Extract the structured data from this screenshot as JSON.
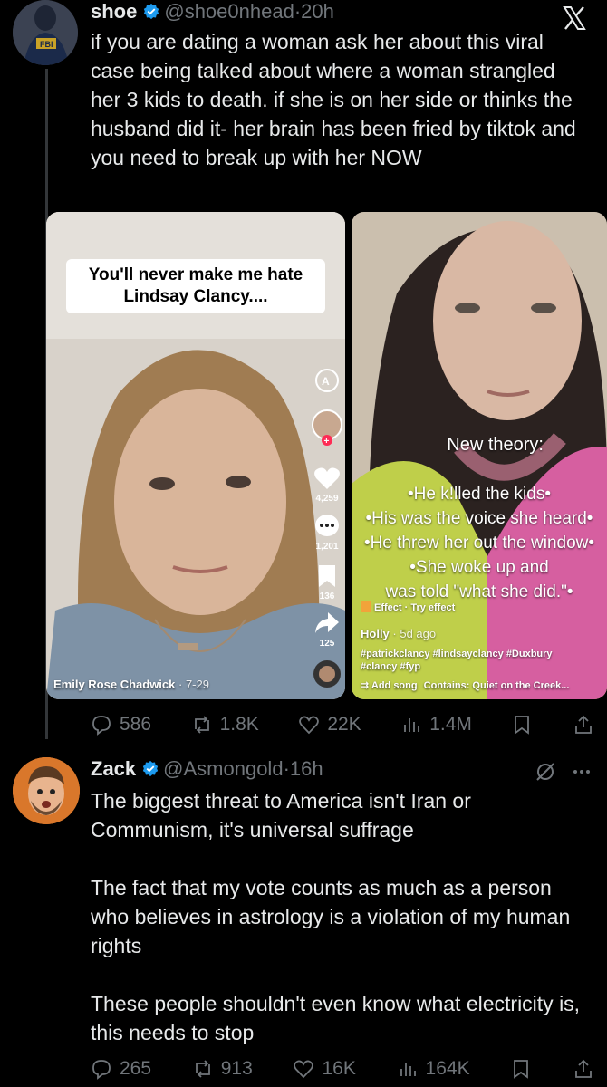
{
  "tweet1": {
    "name": "shoe",
    "handle": "@shoe0nhead",
    "sep": "·",
    "time": "20h",
    "text": "if you are dating a woman ask her about this viral case being talked about where a woman strangled her 3 kids to death. if she is on her side or thinks the husband did it- her brain has been fried by tiktok and you need to break up with her NOW",
    "media_left": {
      "caption_line1": "You'll never make me hate",
      "caption_line2": "Lindsay Clancy....",
      "likes": "4,259",
      "comments": "1,201",
      "bookmarks": "136",
      "shares": "125",
      "author": "Emily Rose Chadwick",
      "date": "· 7-29"
    },
    "media_right": {
      "title": "New theory:",
      "lines": [
        "•He k!lled the kids•",
        "•His was the voice she heard•",
        "•He threw her out the window•",
        "•She woke up and",
        "was told \"what she did.\"•"
      ],
      "effect": "Effect · Try effect",
      "author": "Holly",
      "ago": "· 5d ago",
      "tags1": "#patrickclancy #lindsayclancy #Duxbury",
      "tags2": "#clancy #fyp",
      "add_song": "Add song",
      "contains": "Contains: Quiet on the Creek..."
    },
    "stats": {
      "replies": "586",
      "reposts": "1.8K",
      "likes": "22K",
      "views": "1.4M"
    }
  },
  "tweet2": {
    "name": "Zack",
    "handle": "@Asmongold",
    "sep": "·",
    "time": "16h",
    "para1": "The biggest threat to America isn't Iran or Communism, it's universal suffrage",
    "para2": "The fact that my vote counts as much as a person who believes in astrology is a violation of my human rights",
    "para3": "These people shouldn't even know what electricity is, this needs to stop",
    "stats": {
      "replies": "265",
      "reposts": "913",
      "likes": "16K",
      "views": "164K"
    }
  },
  "colors": {
    "background": "#000000",
    "text": "#e7e9ea",
    "muted": "#71767b",
    "verified": "#1d9bf0"
  }
}
